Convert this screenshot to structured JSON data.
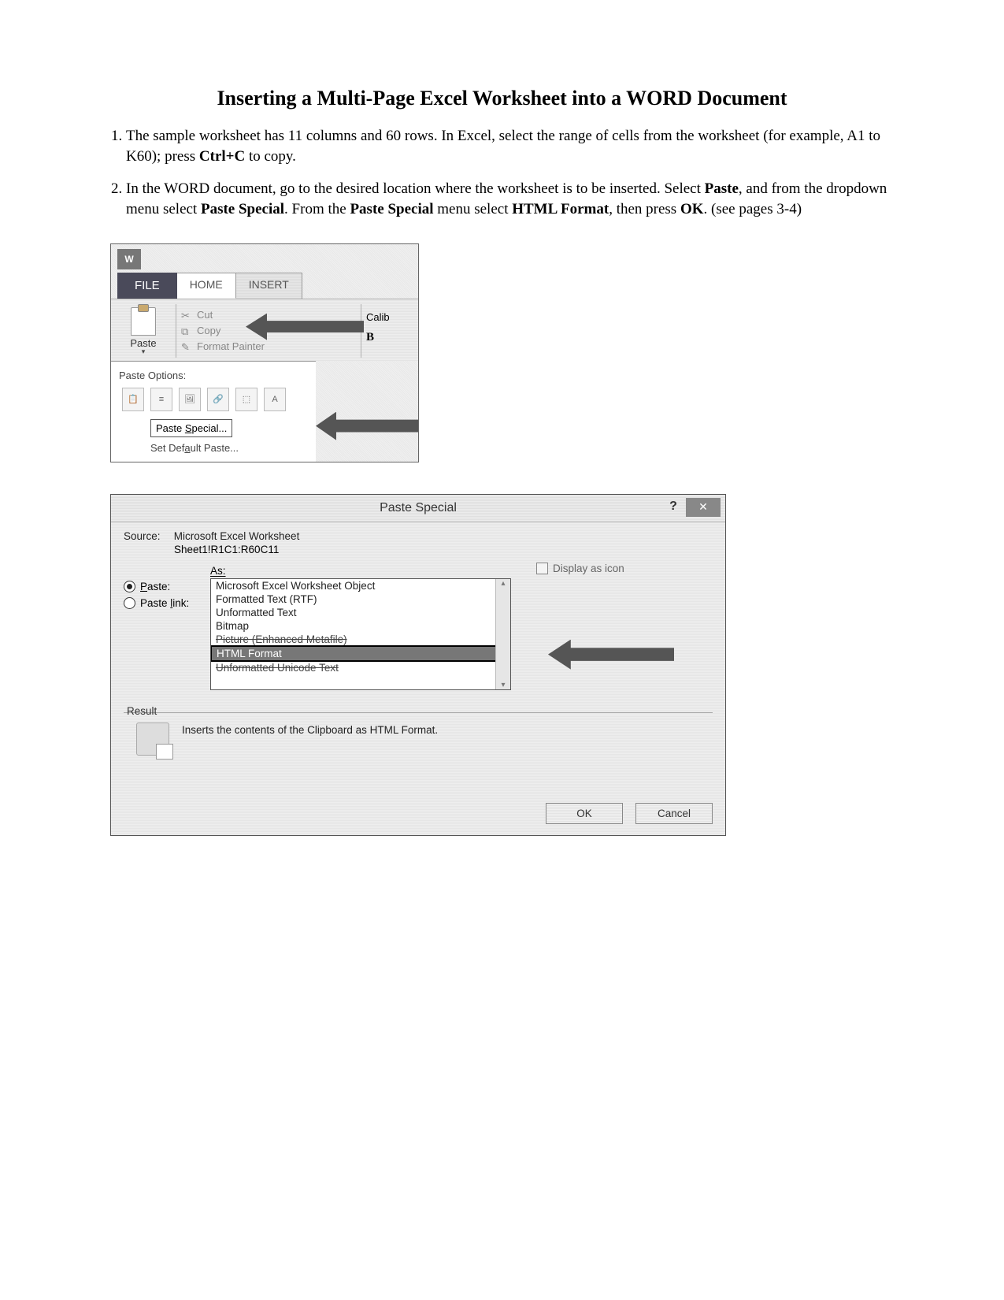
{
  "title": "Inserting a Multi-Page Excel Worksheet into a WORD Document",
  "steps": {
    "s1a": "The sample worksheet has 11 columns and 60 rows. In Excel, select the range of cells from the worksheet (for example, A1 to K60); press ",
    "s1b": "Ctrl+C",
    "s1c": " to copy.",
    "s2a": "In the WORD document, go to the desired location where the worksheet is to be inserted. Select ",
    "s2b": "Paste",
    "s2c": ", and from the dropdown menu select ",
    "s2d": "Paste Special",
    "s2e": ". From the ",
    "s2f": "Paste Special",
    "s2g": " menu select ",
    "s2h": "HTML Format",
    "s2i": ", then press ",
    "s2j": "OK",
    "s2k": ". (see pages 3-4)"
  },
  "ribbon": {
    "app_icon_letter": "W",
    "tab_file": "FILE",
    "tab_home": "HOME",
    "tab_insert": "INSERT",
    "paste_label": "Paste",
    "cut": "Cut",
    "copy": "Copy",
    "format_painter": "Format Painter",
    "font_name": "Calib",
    "bold_letter": "B",
    "po_title": "Paste Options:",
    "paste_special": "Paste Special...",
    "set_default_paste": "Set Default Paste..."
  },
  "dialog": {
    "title": "Paste Special",
    "help": "?",
    "close": "✕",
    "source_label": "Source:",
    "source_value": "Microsoft Excel Worksheet",
    "source_sub": "Sheet1!R1C1:R60C11",
    "as_label": "As:",
    "radio_paste": "Paste:",
    "radio_paste_link": "Paste link:",
    "formats": {
      "f1": "Microsoft Excel Worksheet Object",
      "f2": "Formatted Text (RTF)",
      "f3": "Unformatted Text",
      "f4": "Bitmap",
      "f5": "Picture (Enhanced Metafile)",
      "f6": "HTML Format",
      "f7": "Unformatted Unicode Text"
    },
    "display_as_icon": "Display as icon",
    "result_label": "Result",
    "result_text": "Inserts the contents of the Clipboard as HTML Format.",
    "ok": "OK",
    "cancel": "Cancel"
  }
}
